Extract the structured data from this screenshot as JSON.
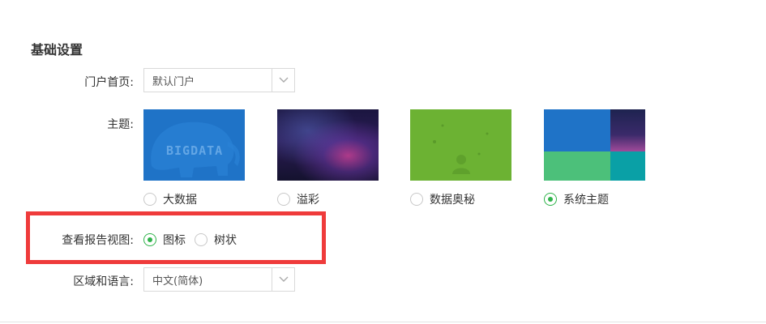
{
  "section": {
    "title": "基础设置"
  },
  "portal": {
    "label": "门户首页:",
    "value": "默认门户"
  },
  "theme": {
    "label": "主题:",
    "options": [
      {
        "label": "大数据",
        "thumb_text": "BIGDATA",
        "checked": false
      },
      {
        "label": "溢彩",
        "checked": false
      },
      {
        "label": "数据奥秘",
        "checked": false
      },
      {
        "label": "系统主题",
        "checked": true
      }
    ]
  },
  "report_view": {
    "label": "查看报告视图:",
    "options": [
      {
        "label": "图标",
        "checked": true
      },
      {
        "label": "树状",
        "checked": false
      }
    ]
  },
  "region": {
    "label": "区域和语言:",
    "value": "中文(简体)"
  },
  "colors": {
    "accent_green": "#2fb34a",
    "highlight_red": "#ef3b3b",
    "bigdata_blue": "#1f73c7",
    "secret_green": "#6cb233",
    "system_teal": "#0aa0a6",
    "system_green": "#4cc07a"
  }
}
